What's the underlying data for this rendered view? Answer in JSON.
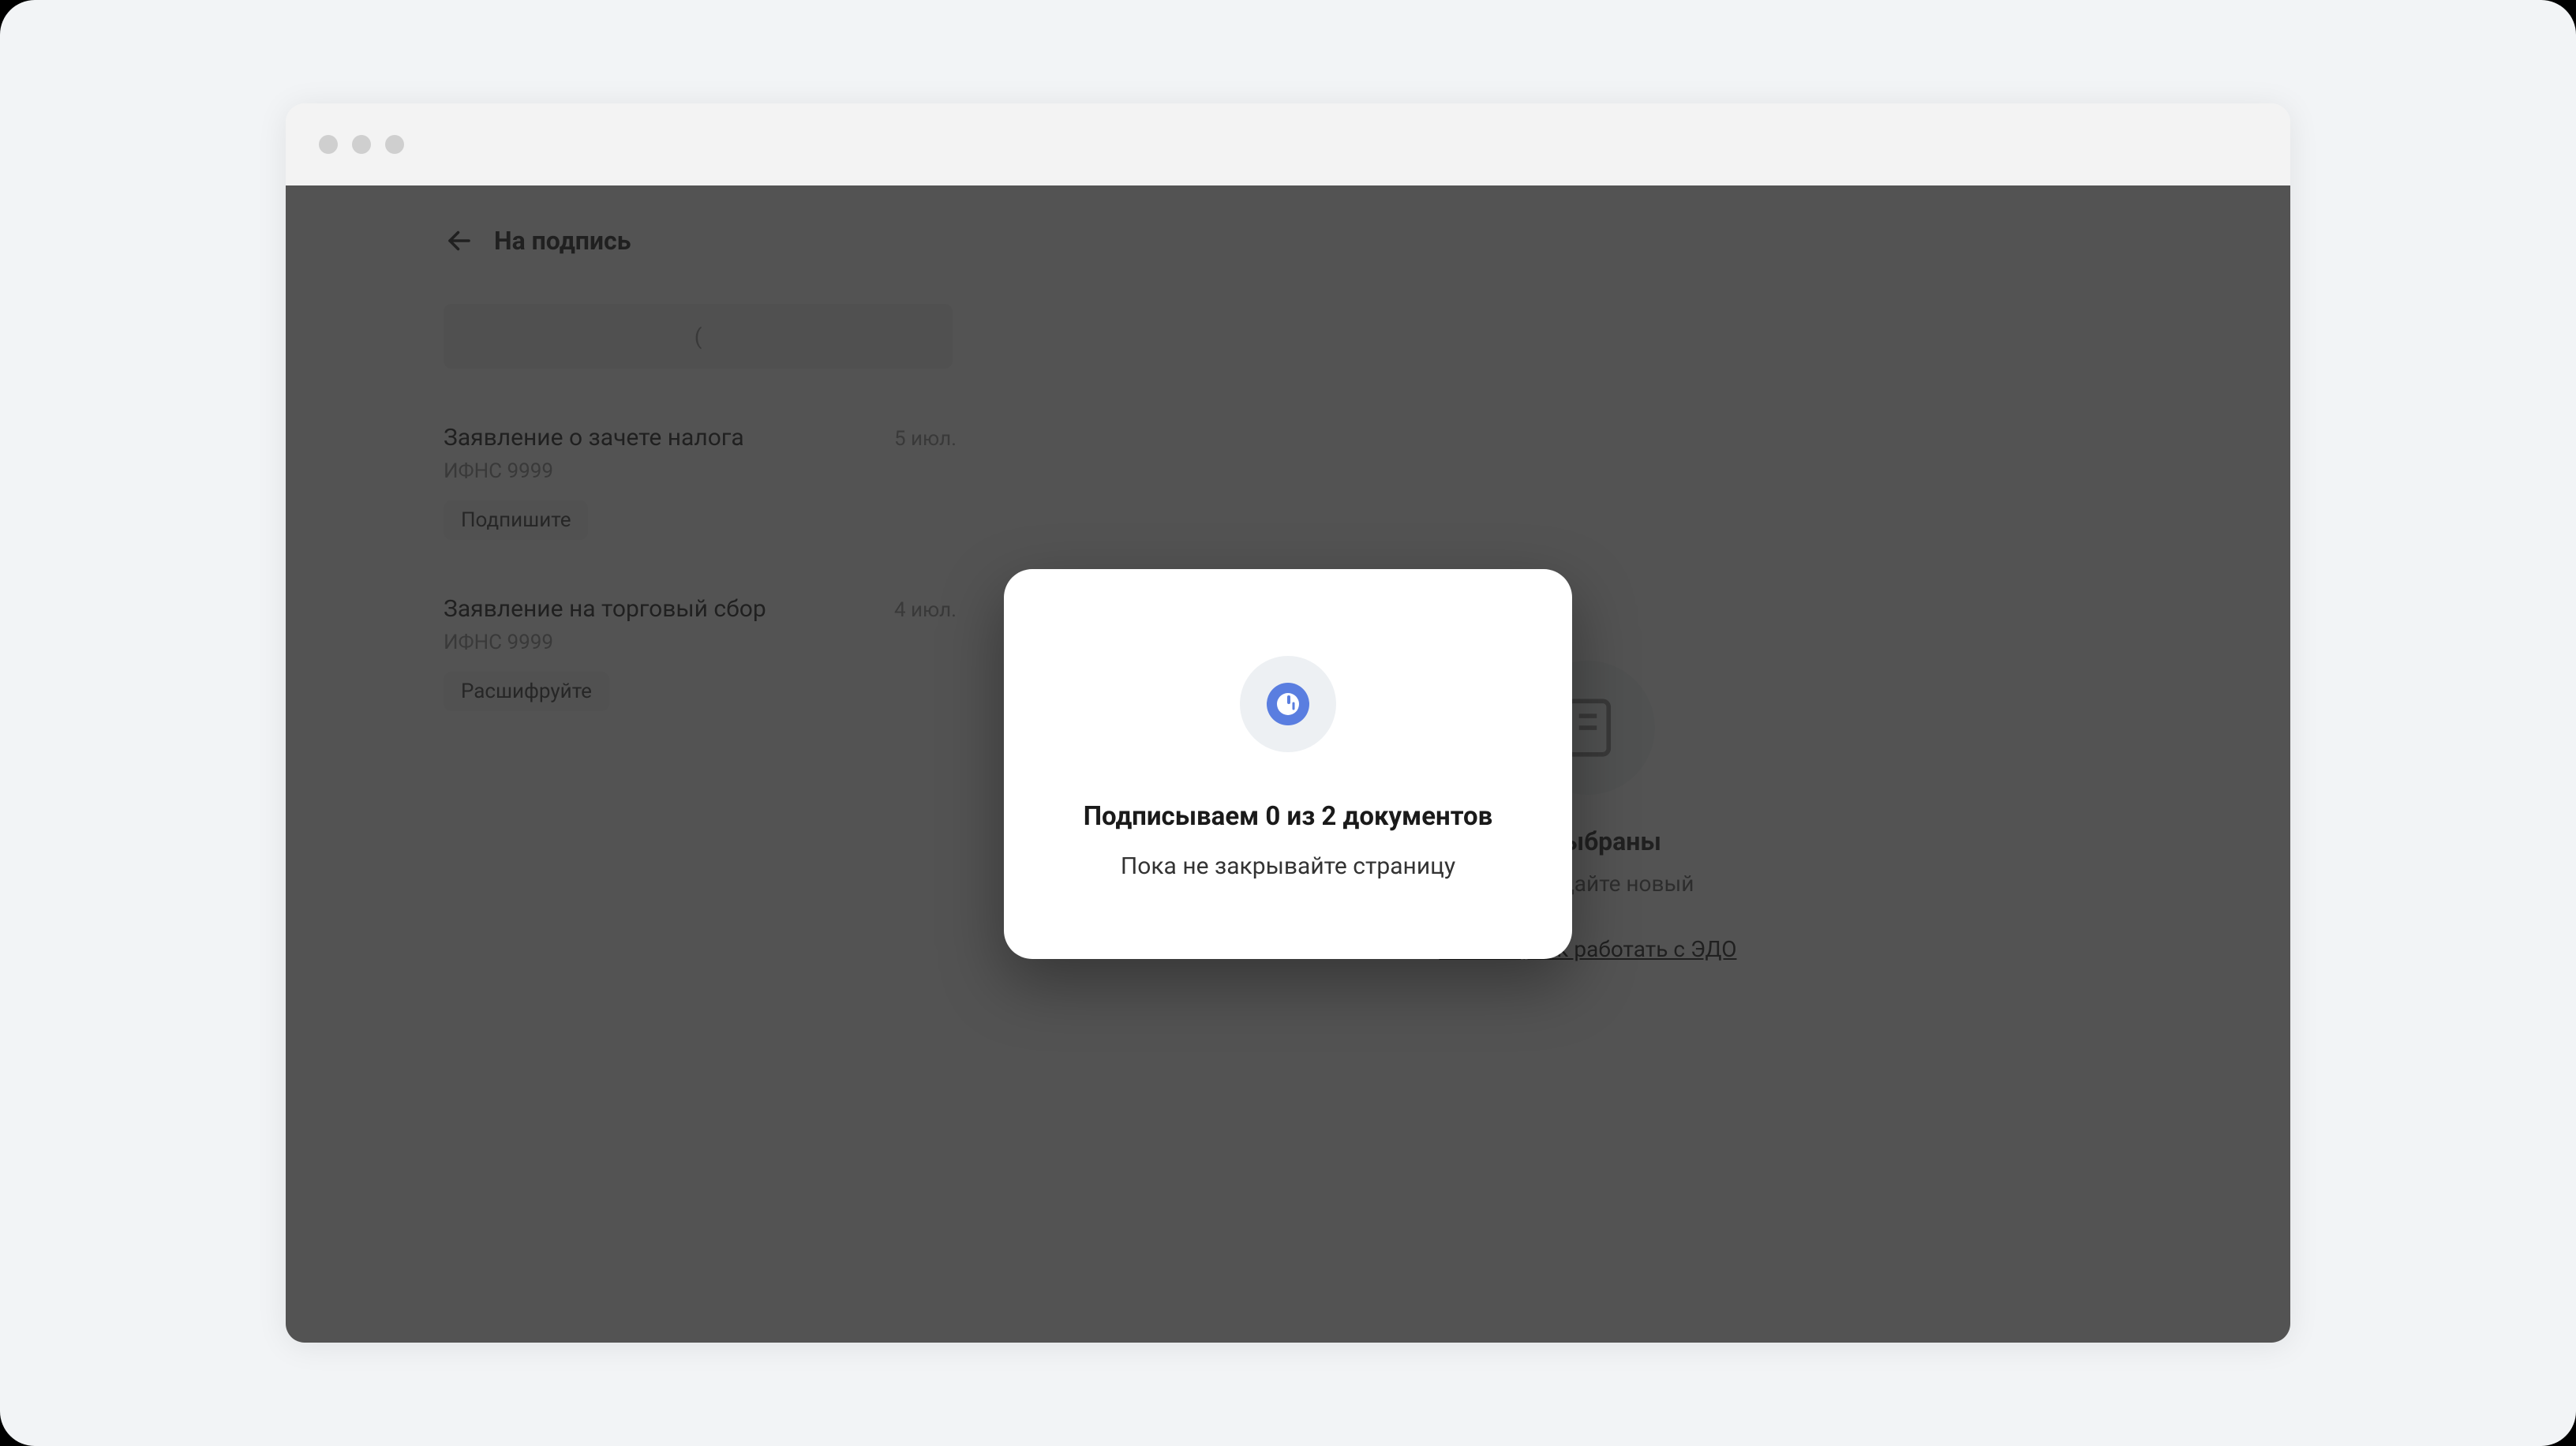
{
  "header": {
    "page_title": "На подпись"
  },
  "skeleton_placeholder": "(",
  "documents": [
    {
      "title": "Заявление о зачете налога",
      "date": "5 июл.",
      "sub": "ИФНС 9999",
      "badge": "Подпишите"
    },
    {
      "title": "Заявление на торговый сбор",
      "date": "4 июл.",
      "sub": "ИФНС 9999",
      "badge": "Расшифруйте"
    }
  ],
  "empty_state": {
    "title_visible_fragment": "не выбраны",
    "sub_visible_fragment": "или создайте новый",
    "link": "Узнайте, как работать с ЭДО"
  },
  "modal": {
    "title": "Подписываем 0 из 2 документов",
    "subtitle": "Пока не закрывайте страницу"
  }
}
